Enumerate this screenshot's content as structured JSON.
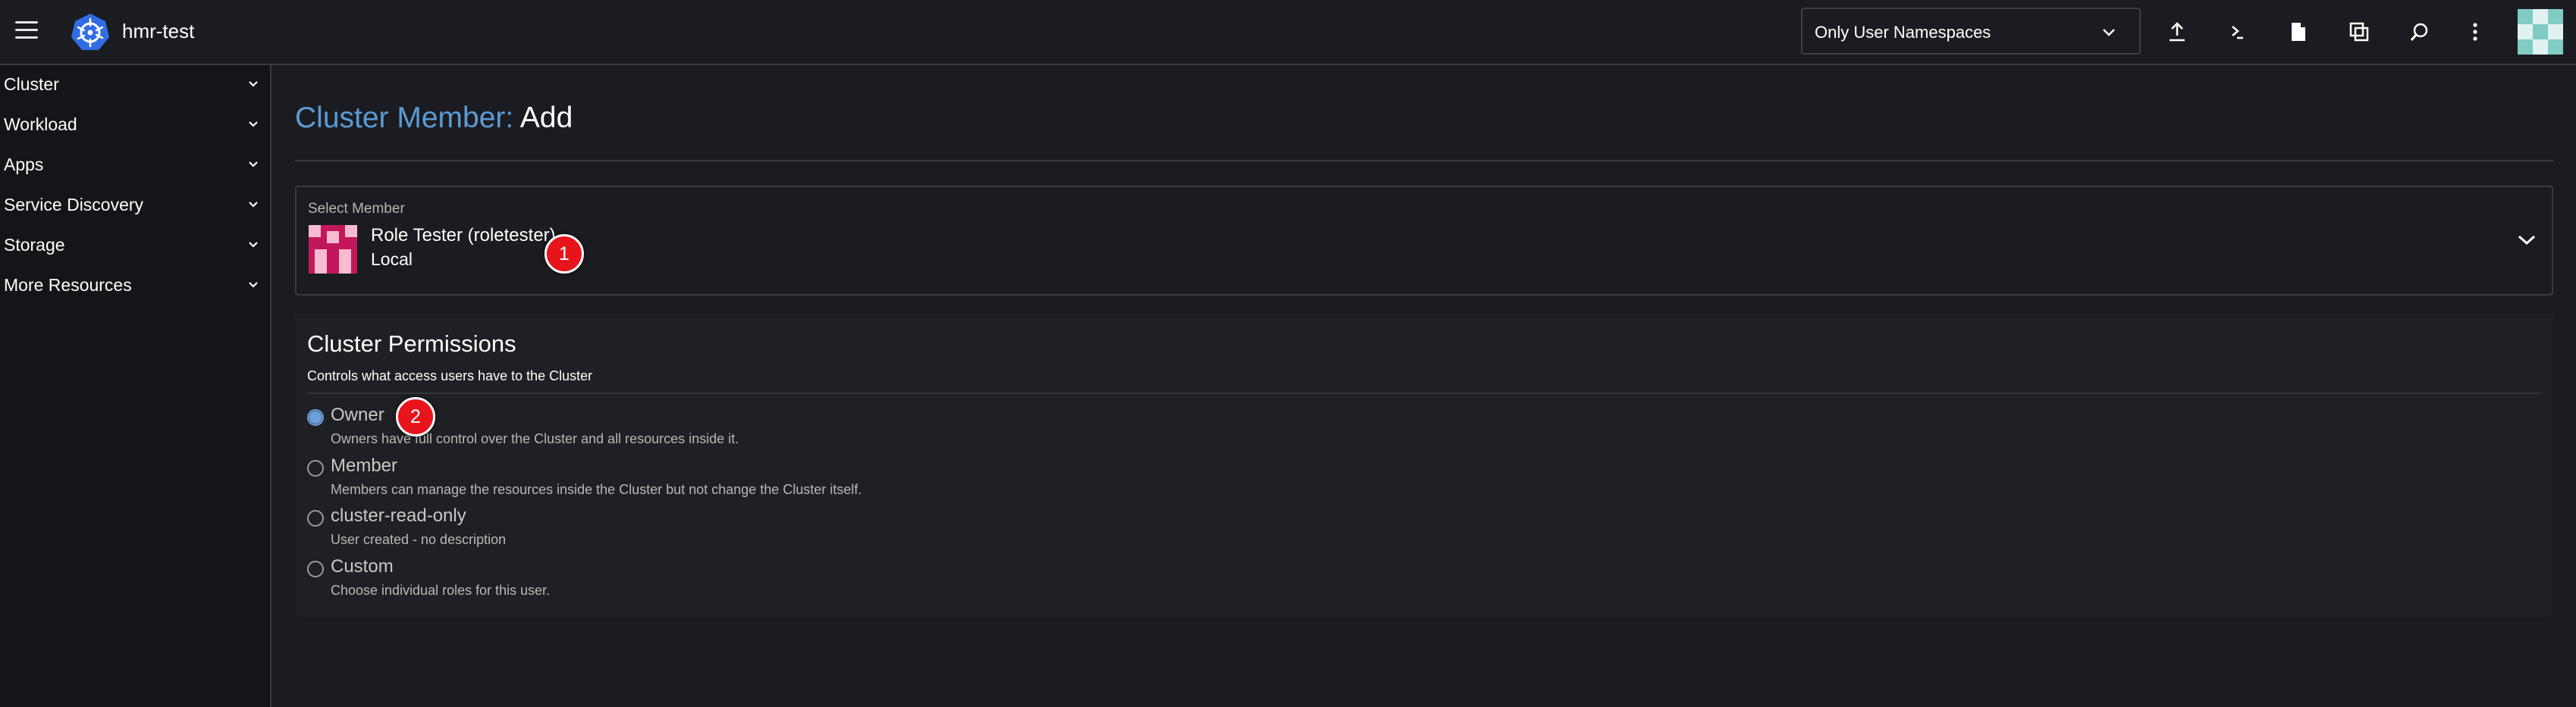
{
  "header": {
    "cluster_name": "hmr-test",
    "namespace_filter": "Only User Namespaces",
    "icons": [
      "menu-icon",
      "kubernetes-logo-icon",
      "upload-icon",
      "terminal-icon",
      "file-icon",
      "copy-config-icon",
      "search-icon",
      "more-vertical-icon",
      "user-avatar-icon"
    ]
  },
  "sidebar": {
    "items": [
      {
        "label": "Cluster"
      },
      {
        "label": "Workload"
      },
      {
        "label": "Apps"
      },
      {
        "label": "Service Discovery"
      },
      {
        "label": "Storage"
      },
      {
        "label": "More Resources"
      }
    ]
  },
  "page": {
    "title_resource": "Cluster Member:",
    "title_action": "Add"
  },
  "member": {
    "label": "Select Member",
    "name": "Role Tester (roletester)",
    "provider": "Local"
  },
  "badges": {
    "first": "1",
    "second": "2"
  },
  "permissions": {
    "title": "Cluster Permissions",
    "subtitle": "Controls what access users have to the Cluster",
    "selected": "Owner",
    "options": [
      {
        "label": "Owner",
        "description": "Owners have full control over the Cluster and all resources inside it."
      },
      {
        "label": "Member",
        "description": "Members can manage the resources inside the Cluster but not change the Cluster itself."
      },
      {
        "label": "cluster-read-only",
        "description": "User created - no description"
      },
      {
        "label": "Custom",
        "description": "Choose individual roles for this user."
      }
    ]
  },
  "colors": {
    "accent": "#5b9bd5",
    "badge": "#e8141c",
    "background": "#1b1c21",
    "sidebar": "#141419",
    "avatar_member": "#c2185b",
    "avatar_header": "#80cbc4"
  }
}
